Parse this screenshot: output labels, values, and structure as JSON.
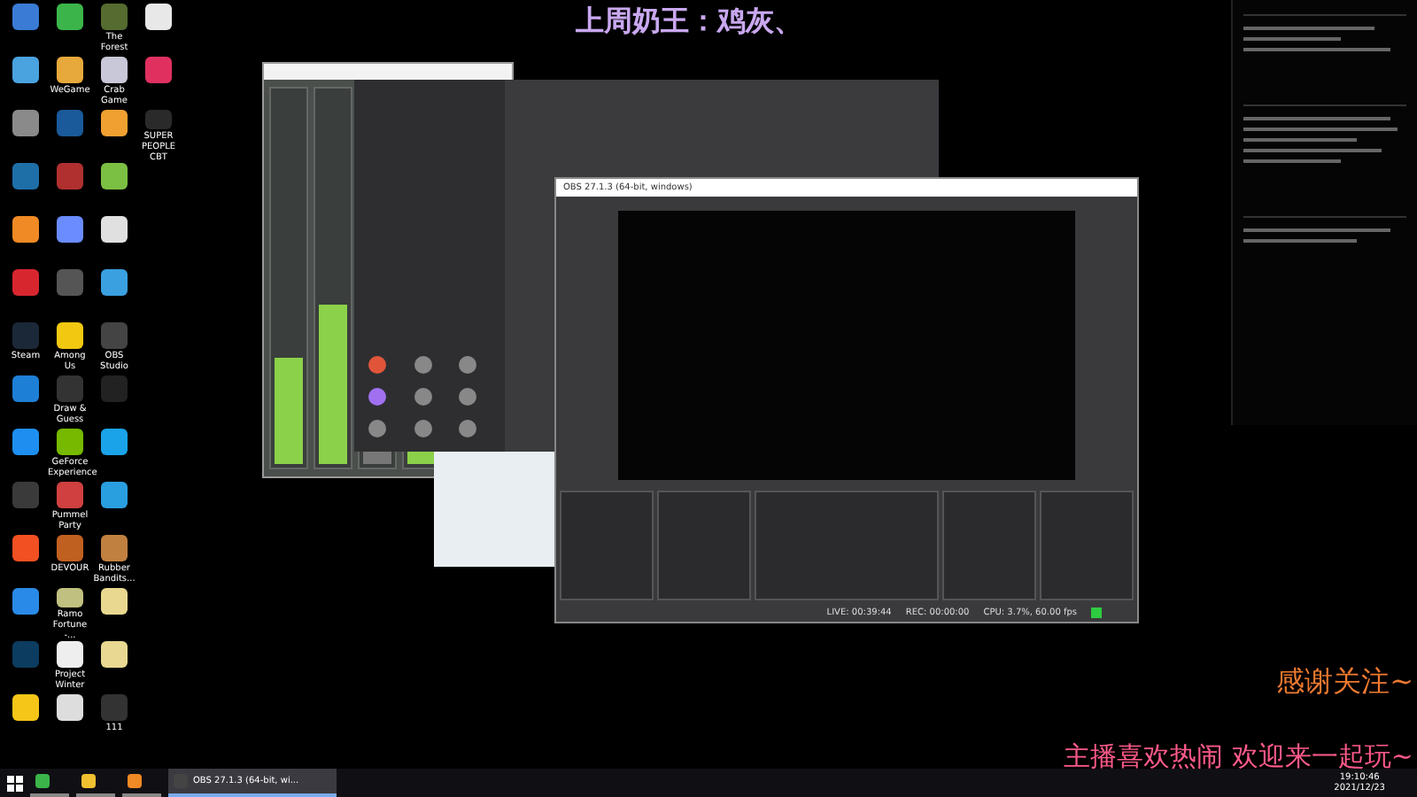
{
  "overlay": {
    "top_banner": "上周奶王：鸡灰、",
    "thanks": "感谢关注~",
    "welcome": "主播喜欢热闹 欢迎来一起玩~"
  },
  "desktop_icons": [
    {
      "color": "#3a7bd5"
    },
    {
      "color": "#4aa3df"
    },
    {
      "color": "#8a8a8a"
    },
    {
      "color": "#1e6fa8"
    },
    {
      "color": "#f08a24"
    },
    {
      "color": "#d8262f"
    },
    {
      "label": "Steam",
      "color": "#1b2838"
    },
    {
      "color": "#1e7fd6"
    },
    {
      "color": "#1e8ff0"
    },
    {
      "color": "#3a3a3a"
    },
    {
      "color": "#f25022"
    },
    {
      "color": "#2a8ae8"
    },
    {
      "color": "#0c3c60"
    },
    {
      "color": "#f5c518"
    },
    {
      "color": "#3bb54a"
    },
    {
      "label": "WeGame",
      "color": "#e8a93c"
    },
    {
      "color": "#1a5a9a"
    },
    {
      "color": "#b03030"
    },
    {
      "color": "#6a8cff"
    },
    {
      "color": "#555555"
    },
    {
      "label": "Among Us",
      "color": "#f2c811"
    },
    {
      "label": "Draw & Guess",
      "color": "#333333"
    },
    {
      "label": "GeForce Experience",
      "color": "#76b900"
    },
    {
      "label": "Pummel Party",
      "color": "#d04040"
    },
    {
      "label": "DEVOUR",
      "color": "#c06020"
    },
    {
      "label": "Ramo Fortune -...",
      "color": "#c0c080"
    },
    {
      "label": "Project Winter",
      "color": "#eeeeee"
    },
    {
      "color": "#dddddd"
    },
    {
      "label": "The Forest",
      "color": "#556b2f"
    },
    {
      "label": "Crab Game",
      "color": "#c8c8d8"
    },
    {
      "color": "#f0a030"
    },
    {
      "color": "#7bc043"
    },
    {
      "color": "#e0e0e0"
    },
    {
      "color": "#3aa0e0"
    },
    {
      "label": "OBS Studio",
      "color": "#444444"
    },
    {
      "color": "#222222"
    },
    {
      "color": "#1aa3e8"
    },
    {
      "color": "#2a9fe0"
    },
    {
      "label": "Rubber Bandits...",
      "color": "#c08040"
    },
    {
      "color": "#e8d890"
    },
    {
      "color": "#e8d891"
    },
    {
      "label": "111",
      "color": "#333334"
    },
    {
      "color": "#e8e8e8"
    },
    {
      "color": "#e03060"
    },
    {
      "label": "SUPER PEOPLE CBT",
      "color": "#2a2a2a"
    }
  ],
  "obs": {
    "title": "OBS 27.1.3 (64-bit, windows)",
    "status": [
      "LIVE: 00:39:44",
      "REC: 00:00:00",
      "CPU: 3.7%, 60.00 fps"
    ]
  },
  "taskbar": {
    "items": [
      {
        "selected": false,
        "color": "#3bb54a"
      },
      {
        "selected": false,
        "color": "#f0c030"
      },
      {
        "selected": false,
        "color": "#f08a24"
      },
      {
        "label": "OBS 27.1.3 (64-bit, wi...",
        "selected": true,
        "color": "#444444"
      }
    ],
    "time": "19:10:46",
    "date": "2021/12/23"
  }
}
